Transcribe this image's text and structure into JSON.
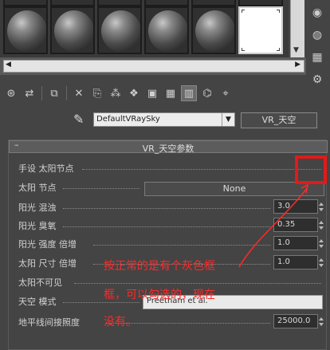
{
  "material_name": "DefaultVRaySky",
  "material_type_button": "VR_天空",
  "rollout": {
    "toggle": "–",
    "title": "VR_天空参数"
  },
  "params": {
    "manual_sun": "手设 太阳节点",
    "sun_node": "太阳 节点",
    "sun_node_value": "None",
    "turbidity": "阳光 混浊",
    "turbidity_value": "3.0",
    "ozone": "阳光 臭氧",
    "ozone_value": "0.35",
    "intensity_mult": "阳光 强度 倍增",
    "intensity_mult_value": "1.0",
    "size_mult": "太阳 尺寸 倍增",
    "size_mult_value": "1.0",
    "sun_invisible": "太阳不可见",
    "sky_model": "天空 模式",
    "sky_model_value": "Preetham et al.",
    "indirect_horiz": "地平线间接照度",
    "indirect_horiz_value": "25000.0"
  },
  "annotation": {
    "line1": "按正常的是有个灰色框",
    "line2": "框，可以勾选的，现在",
    "line3": "没有。"
  },
  "colors": {
    "annotation_red": "#ff2a2a",
    "highlight_box": "#e21a1a"
  }
}
